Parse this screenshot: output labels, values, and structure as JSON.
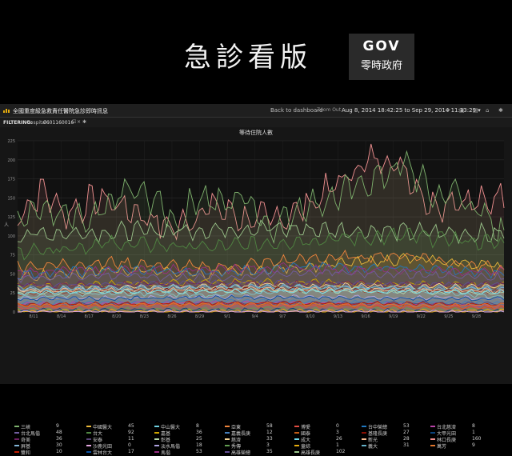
{
  "slide": {
    "title": "急診看版"
  },
  "logo": {
    "line1": "GOV",
    "line2": "零時政府"
  },
  "toolbar": {
    "app_title": "全國重度級急救責任醫院急診即時訊息",
    "back_label": "Back to dashboard",
    "zoom_label": "Zoom Out",
    "time_range": "Aug 8, 2014 18:42:25 to Sep 29, 2014 11:23:29 ▾"
  },
  "filter": {
    "label": "FILTERING:",
    "key": "hospital :",
    "value": "0601160016"
  },
  "panel": {
    "title": "等待住院人數"
  },
  "chart_data": {
    "type": "area",
    "title": "等待住院人數",
    "ylabel": "人",
    "ylim": [
      0,
      225
    ],
    "yticks": [
      "0",
      "25",
      "50",
      "75",
      "100",
      "125",
      "150",
      "175",
      "200",
      "225"
    ],
    "xticks": [
      "8/11",
      "8/14",
      "8/17",
      "8/20",
      "8/23",
      "8/26",
      "8/29",
      "9/1",
      "9/4",
      "9/7",
      "9/10",
      "9/13",
      "9/16",
      "9/19",
      "9/22",
      "9/25",
      "9/28"
    ],
    "grid": true,
    "series": [
      {
        "name": "三峽",
        "color": "#7eb26d",
        "shape": [
          [
            0,
            130
          ],
          [
            0.05,
            135
          ],
          [
            0.1,
            125
          ],
          [
            0.15,
            115
          ],
          [
            0.22,
            160
          ],
          [
            0.28,
            150
          ],
          [
            0.33,
            115
          ],
          [
            0.37,
            155
          ],
          [
            0.42,
            140
          ],
          [
            0.47,
            155
          ],
          [
            0.52,
            110
          ],
          [
            0.58,
            140
          ],
          [
            0.63,
            145
          ],
          [
            0.7,
            165
          ],
          [
            0.75,
            180
          ],
          [
            0.8,
            195
          ],
          [
            0.86,
            150
          ],
          [
            0.9,
            160
          ],
          [
            0.95,
            130
          ],
          [
            1.0,
            100
          ]
        ]
      },
      {
        "name": "中國醫大",
        "color": "#eab839",
        "shape": [
          [
            0,
            45
          ],
          [
            0.2,
            55
          ],
          [
            0.4,
            50
          ],
          [
            0.6,
            60
          ],
          [
            0.8,
            70
          ],
          [
            1.0,
            60
          ]
        ]
      },
      {
        "name": "中山醫大",
        "color": "#6ed0e0",
        "shape": [
          [
            0,
            20
          ],
          [
            0.2,
            25
          ],
          [
            0.4,
            22
          ],
          [
            0.6,
            30
          ],
          [
            0.8,
            28
          ],
          [
            1.0,
            20
          ]
        ]
      },
      {
        "name": "亞東",
        "color": "#ef843c",
        "shape": [
          [
            0,
            60
          ],
          [
            0.2,
            65
          ],
          [
            0.4,
            58
          ],
          [
            0.6,
            70
          ],
          [
            0.8,
            75
          ],
          [
            1.0,
            55
          ]
        ]
      },
      {
        "name": "博愛",
        "color": "#e24d42",
        "shape": [
          [
            0,
            5
          ],
          [
            0.3,
            10
          ],
          [
            0.6,
            8
          ],
          [
            1.0,
            6
          ]
        ]
      },
      {
        "name": "台中榮總",
        "color": "#1f78c1",
        "shape": [
          [
            0,
            50
          ],
          [
            0.2,
            55
          ],
          [
            0.4,
            52
          ],
          [
            0.6,
            60
          ],
          [
            0.8,
            58
          ],
          [
            1.0,
            50
          ]
        ]
      },
      {
        "name": "台北慈濟",
        "color": "#ba43a9",
        "shape": [
          [
            0,
            10
          ],
          [
            0.5,
            12
          ],
          [
            1.0,
            8
          ]
        ]
      },
      {
        "name": "台北馬偕",
        "color": "#705da0",
        "shape": [
          [
            0,
            45
          ],
          [
            0.2,
            48
          ],
          [
            0.4,
            44
          ],
          [
            0.6,
            52
          ],
          [
            0.8,
            50
          ],
          [
            1.0,
            45
          ]
        ]
      },
      {
        "name": "台大",
        "color": "#508642",
        "shape": [
          [
            0,
            80
          ],
          [
            0.2,
            90
          ],
          [
            0.4,
            85
          ],
          [
            0.6,
            95
          ],
          [
            0.8,
            100
          ],
          [
            1.0,
            90
          ]
        ]
      },
      {
        "name": "嘉基",
        "color": "#cca300",
        "shape": [
          [
            0,
            35
          ],
          [
            0.5,
            40
          ],
          [
            1.0,
            35
          ]
        ]
      },
      {
        "name": "嘉義長庚",
        "color": "#447ebc",
        "shape": [
          [
            0,
            12
          ],
          [
            0.5,
            14
          ],
          [
            1.0,
            12
          ]
        ]
      },
      {
        "name": "國泰",
        "color": "#c15c17",
        "shape": [
          [
            0,
            8
          ],
          [
            0.5,
            10
          ],
          [
            1.0,
            5
          ]
        ]
      },
      {
        "name": "基隆長庚",
        "color": "#890f02",
        "shape": [
          [
            0,
            25
          ],
          [
            0.5,
            30
          ],
          [
            1.0,
            27
          ]
        ]
      },
      {
        "name": "大甲光田",
        "color": "#0a437c",
        "shape": [
          [
            0,
            2
          ],
          [
            0.5,
            3
          ],
          [
            1.0,
            1
          ]
        ]
      },
      {
        "name": "奇美",
        "color": "#6d1f62",
        "shape": [
          [
            0,
            35
          ],
          [
            0.5,
            38
          ],
          [
            1.0,
            36
          ]
        ]
      },
      {
        "name": "安泰",
        "color": "#584477",
        "shape": [
          [
            0,
            10
          ],
          [
            0.5,
            12
          ],
          [
            1.0,
            11
          ]
        ]
      },
      {
        "name": "彰基",
        "color": "#b7dbab",
        "shape": [
          [
            0,
            25
          ],
          [
            0.5,
            28
          ],
          [
            1.0,
            25
          ]
        ]
      },
      {
        "name": "慈濟",
        "color": "#f4d598",
        "shape": [
          [
            0,
            30
          ],
          [
            0.5,
            35
          ],
          [
            1.0,
            33
          ]
        ]
      },
      {
        "name": "成大",
        "color": "#70dbed",
        "shape": [
          [
            0,
            25
          ],
          [
            0.5,
            28
          ],
          [
            1.0,
            26
          ]
        ]
      },
      {
        "name": "新光",
        "color": "#f9ba8f",
        "shape": [
          [
            0,
            28
          ],
          [
            0.5,
            30
          ],
          [
            1.0,
            28
          ]
        ]
      },
      {
        "name": "林口長庚",
        "color": "#f29191",
        "shape": [
          [
            0,
            125
          ],
          [
            0.05,
            160
          ],
          [
            0.1,
            130
          ],
          [
            0.17,
            150
          ],
          [
            0.25,
            130
          ],
          [
            0.32,
            110
          ],
          [
            0.4,
            140
          ],
          [
            0.48,
            120
          ],
          [
            0.55,
            125
          ],
          [
            0.62,
            150
          ],
          [
            0.7,
            190
          ],
          [
            0.75,
            205
          ],
          [
            0.8,
            185
          ],
          [
            0.85,
            140
          ],
          [
            0.9,
            150
          ],
          [
            0.96,
            140
          ],
          [
            1.0,
            160
          ]
        ]
      },
      {
        "name": "屏基",
        "color": "#82b5d8",
        "shape": [
          [
            0,
            30
          ],
          [
            0.5,
            33
          ],
          [
            1.0,
            30
          ]
        ]
      },
      {
        "name": "沙鹿光田",
        "color": "#e5a8e2",
        "shape": [
          [
            0,
            0
          ],
          [
            1.0,
            0
          ]
        ]
      },
      {
        "name": "淡水馬偕",
        "color": "#aea2e0",
        "shape": [
          [
            0,
            18
          ],
          [
            0.5,
            20
          ],
          [
            1.0,
            18
          ]
        ]
      },
      {
        "name": "秀傳",
        "color": "#629e51",
        "shape": [
          [
            0,
            3
          ],
          [
            0.5,
            4
          ],
          [
            1.0,
            3
          ]
        ]
      },
      {
        "name": "童綜",
        "color": "#e5ac0e",
        "shape": [
          [
            0,
            1
          ],
          [
            1.0,
            1
          ]
        ]
      },
      {
        "name": "義大",
        "color": "#64b0c8",
        "shape": [
          [
            0,
            31
          ],
          [
            0.5,
            33
          ],
          [
            1.0,
            31
          ]
        ]
      },
      {
        "name": "萬芳",
        "color": "#e0752d",
        "shape": [
          [
            0,
            9
          ],
          [
            0.5,
            10
          ],
          [
            1.0,
            9
          ]
        ]
      },
      {
        "name": "雙和",
        "color": "#bf1b00",
        "shape": [
          [
            0,
            10
          ],
          [
            0.5,
            12
          ],
          [
            1.0,
            10
          ]
        ]
      },
      {
        "name": "雲林台大",
        "color": "#0a50a1",
        "shape": [
          [
            0,
            17
          ],
          [
            0.5,
            19
          ],
          [
            1.0,
            17
          ]
        ]
      },
      {
        "name": "馬偕",
        "color": "#962d82",
        "shape": [
          [
            0,
            53
          ],
          [
            0.5,
            58
          ],
          [
            1.0,
            53
          ]
        ]
      },
      {
        "name": "高雄榮總",
        "color": "#614d93",
        "shape": [
          [
            0,
            35
          ],
          [
            0.5,
            38
          ],
          [
            1.0,
            35
          ]
        ]
      },
      {
        "name": "高雄長庚",
        "color": "#9ac48a",
        "shape": [
          [
            0,
            102
          ],
          [
            0.5,
            110
          ],
          [
            1.0,
            102
          ]
        ]
      }
    ]
  },
  "legend": [
    [
      {
        "name": "三峽",
        "value": "9",
        "color": "#7eb26d"
      },
      {
        "name": "中國醫大",
        "value": "45",
        "color": "#eab839"
      },
      {
        "name": "中山醫大",
        "value": "8",
        "color": "#6ed0e0"
      },
      {
        "name": "亞東",
        "value": "58",
        "color": "#ef843c"
      },
      {
        "name": "博愛",
        "value": "0",
        "color": "#e24d42"
      },
      {
        "name": "台中榮總",
        "value": "53",
        "color": "#1f78c1"
      },
      {
        "name": "台北慈濟",
        "value": "8",
        "color": "#ba43a9"
      }
    ],
    [
      {
        "name": "台北馬偕",
        "value": "48",
        "color": "#705da0"
      },
      {
        "name": "台大",
        "value": "92",
        "color": "#508642"
      },
      {
        "name": "嘉基",
        "value": "36",
        "color": "#cca300"
      },
      {
        "name": "嘉義長庚",
        "value": "12",
        "color": "#447ebc"
      },
      {
        "name": "國泰",
        "value": "3",
        "color": "#c15c17"
      },
      {
        "name": "基隆長庚",
        "value": "27",
        "color": "#890f02"
      },
      {
        "name": "大甲光田",
        "value": "1",
        "color": "#0a437c"
      }
    ],
    [
      {
        "name": "奇美",
        "value": "36",
        "color": "#6d1f62"
      },
      {
        "name": "安泰",
        "value": "11",
        "color": "#584477"
      },
      {
        "name": "彰基",
        "value": "25",
        "color": "#b7dbab"
      },
      {
        "name": "慈濟",
        "value": "33",
        "color": "#f4d598"
      },
      {
        "name": "成大",
        "value": "26",
        "color": "#70dbed"
      },
      {
        "name": "新光",
        "value": "28",
        "color": "#f9ba8f"
      },
      {
        "name": "林口長庚",
        "value": "160",
        "color": "#f29191"
      }
    ],
    [
      {
        "name": "屏基",
        "value": "30",
        "color": "#82b5d8"
      },
      {
        "name": "沙鹿光田",
        "value": "0",
        "color": "#e5a8e2"
      },
      {
        "name": "淡水馬偕",
        "value": "18",
        "color": "#aea2e0"
      },
      {
        "name": "秀傳",
        "value": "3",
        "color": "#629e51"
      },
      {
        "name": "童綜",
        "value": "1",
        "color": "#e5ac0e"
      },
      {
        "name": "義大",
        "value": "31",
        "color": "#64b0c8"
      },
      {
        "name": "萬芳",
        "value": "9",
        "color": "#e0752d"
      }
    ],
    [
      {
        "name": "雙和",
        "value": "10",
        "color": "#bf1b00"
      },
      {
        "name": "雲林台大",
        "value": "17",
        "color": "#0a50a1"
      },
      {
        "name": "馬偕",
        "value": "53",
        "color": "#962d82"
      },
      {
        "name": "高雄榮總",
        "value": "35",
        "color": "#614d93"
      },
      {
        "name": "高雄長庚",
        "value": "102",
        "color": "#9ac48a"
      }
    ]
  ]
}
